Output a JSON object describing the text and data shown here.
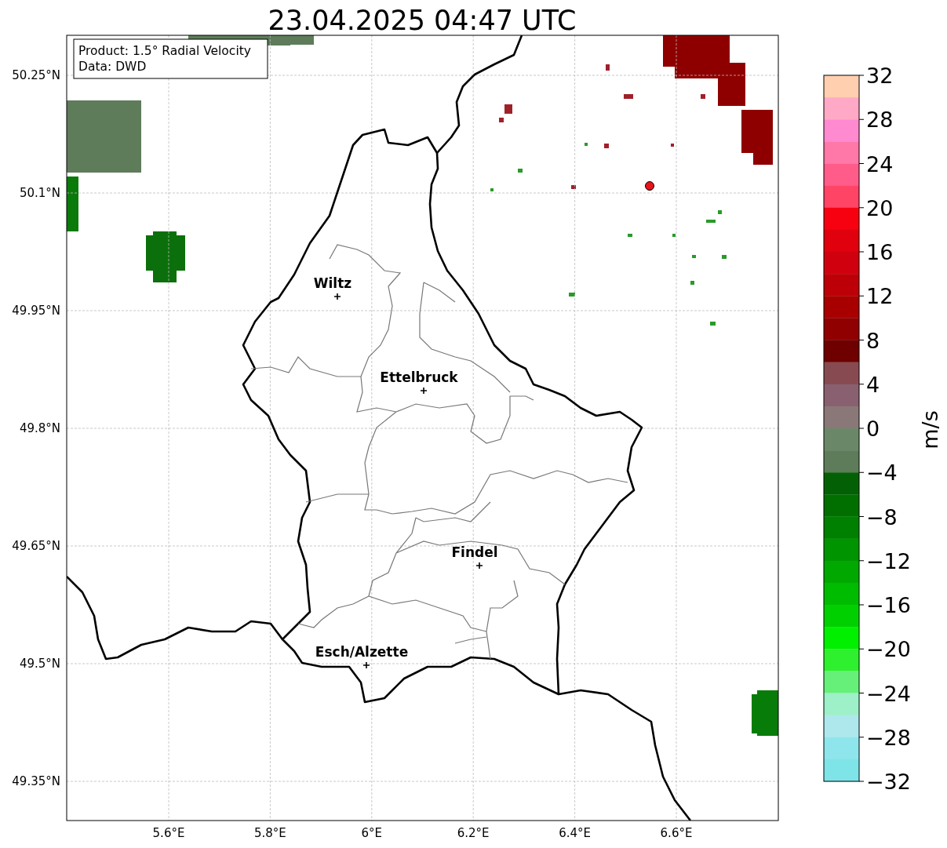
{
  "title": "23.04.2025 04:47 UTC",
  "map": {
    "info_box": [
      "Product: 1.5° Radial Velocity",
      "Data: DWD"
    ],
    "lat_ticks": [
      "50.25°N",
      "50.1°N",
      "49.95°N",
      "49.8°N",
      "49.65°N",
      "49.5°N",
      "49.35°N"
    ],
    "lon_ticks": [
      "5.6°E",
      "5.8°E",
      "6°E",
      "6.2°E",
      "6.4°E",
      "6.6°E"
    ],
    "cities": [
      {
        "name": "Wiltz"
      },
      {
        "name": "Ettelbruck"
      },
      {
        "name": "Findel"
      },
      {
        "name": "Esch/Alzette"
      }
    ]
  },
  "colorbar": {
    "label": "m/s",
    "ticks": [
      "32",
      "28",
      "24",
      "20",
      "16",
      "12",
      "8",
      "4",
      "0",
      "−4",
      "−8",
      "−12",
      "−16",
      "−20",
      "−24",
      "−28",
      "−32"
    ],
    "bins": [
      {
        "color": "#ffcfb0"
      },
      {
        "color": "#ffa9c6"
      },
      {
        "color": "#ff8ad0"
      },
      {
        "color": "#ff78a8"
      },
      {
        "color": "#ff5c8a"
      },
      {
        "color": "#ff4466"
      },
      {
        "color": "#f70010"
      },
      {
        "color": "#e0000e"
      },
      {
        "color": "#d0000e"
      },
      {
        "color": "#bd0008"
      },
      {
        "color": "#a80000"
      },
      {
        "color": "#900000"
      },
      {
        "color": "#6e0000"
      },
      {
        "color": "#874a50"
      },
      {
        "color": "#886070"
      },
      {
        "color": "#8a7878"
      },
      {
        "color": "#6a8868"
      },
      {
        "color": "#5e7c5a"
      },
      {
        "color": "#046004"
      },
      {
        "color": "#006f00"
      },
      {
        "color": "#008000"
      },
      {
        "color": "#009400"
      },
      {
        "color": "#00a800"
      },
      {
        "color": "#00bc00"
      },
      {
        "color": "#00d000"
      },
      {
        "color": "#00f000"
      },
      {
        "color": "#2ef02e"
      },
      {
        "color": "#66f07a"
      },
      {
        "color": "#9ef0c8"
      },
      {
        "color": "#aee8ec"
      },
      {
        "color": "#8ee6ec"
      },
      {
        "color": "#7ee4e8"
      }
    ]
  }
}
